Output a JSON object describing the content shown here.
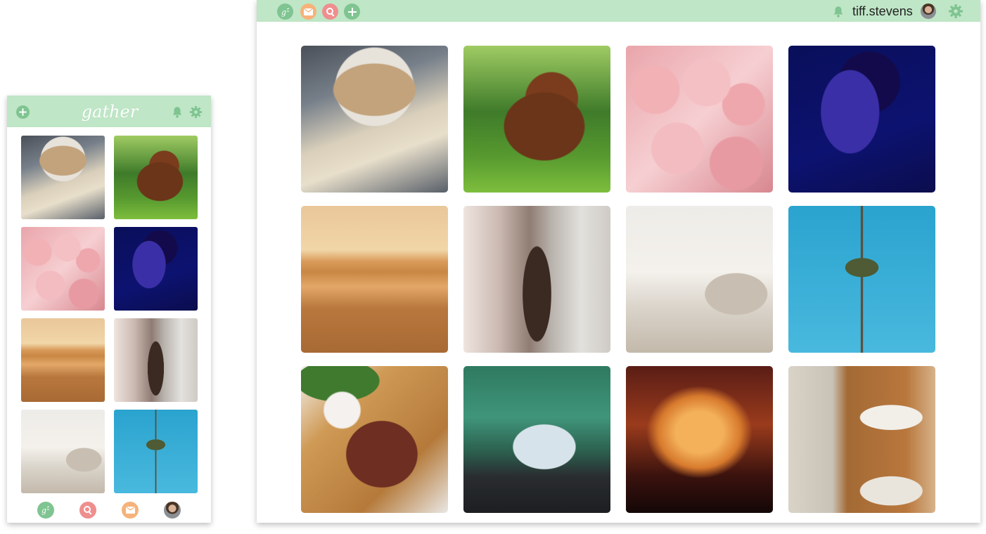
{
  "phone": {
    "logo_text": "gather",
    "header_icons": [
      "plus-icon",
      "bell-icon",
      "gear-icon"
    ],
    "photos": [
      {
        "name": "cookies-book-photo",
        "style": "ph-cookies"
      },
      {
        "name": "dog-grass-photo",
        "style": "ph-dog"
      },
      {
        "name": "pink-roses-photo",
        "style": "ph-roses"
      },
      {
        "name": "blue-face-photo",
        "style": "ph-face"
      },
      {
        "name": "desert-dunes-photo",
        "style": "ph-desert"
      },
      {
        "name": "woman-wall-photo",
        "style": "ph-woman"
      },
      {
        "name": "living-room-photo",
        "style": "ph-room"
      },
      {
        "name": "palm-tree-photo",
        "style": "ph-palm"
      }
    ],
    "bottom_nav": [
      {
        "name": "home-logo-icon",
        "color": "#7fc491"
      },
      {
        "name": "search-icon",
        "color": "#ef8e8e"
      },
      {
        "name": "mail-icon",
        "color": "#f6b27a"
      },
      {
        "name": "profile-avatar",
        "color": "#8a8f94"
      }
    ]
  },
  "desktop": {
    "header_left_icons": [
      {
        "name": "home-logo-icon",
        "color": "#7fc491"
      },
      {
        "name": "mail-icon",
        "color": "#f6b27a"
      },
      {
        "name": "search-icon",
        "color": "#ef8e8e"
      },
      {
        "name": "plus-icon",
        "color": "#7fc491"
      }
    ],
    "username": "tiff.stevens",
    "photos": [
      {
        "name": "cookies-book-photo",
        "style": "ph-cookies"
      },
      {
        "name": "dog-grass-photo",
        "style": "ph-dog"
      },
      {
        "name": "pink-roses-photo",
        "style": "ph-roses"
      },
      {
        "name": "blue-face-photo",
        "style": "ph-face"
      },
      {
        "name": "desert-dunes-photo",
        "style": "ph-desert"
      },
      {
        "name": "woman-wall-photo",
        "style": "ph-woman"
      },
      {
        "name": "living-room-photo",
        "style": "ph-room"
      },
      {
        "name": "palm-tree-photo",
        "style": "ph-palm"
      },
      {
        "name": "steak-board-photo",
        "style": "ph-steak"
      },
      {
        "name": "tent-view-photo",
        "style": "ph-tent"
      },
      {
        "name": "concert-crowd-photo",
        "style": "ph-concert"
      },
      {
        "name": "table-setting-photo",
        "style": "ph-table"
      }
    ]
  },
  "colors": {
    "header_bg": "#bfe6c6",
    "accent_green": "#7fc491",
    "accent_pink": "#ef8e8e",
    "accent_orange": "#f6b27a"
  }
}
